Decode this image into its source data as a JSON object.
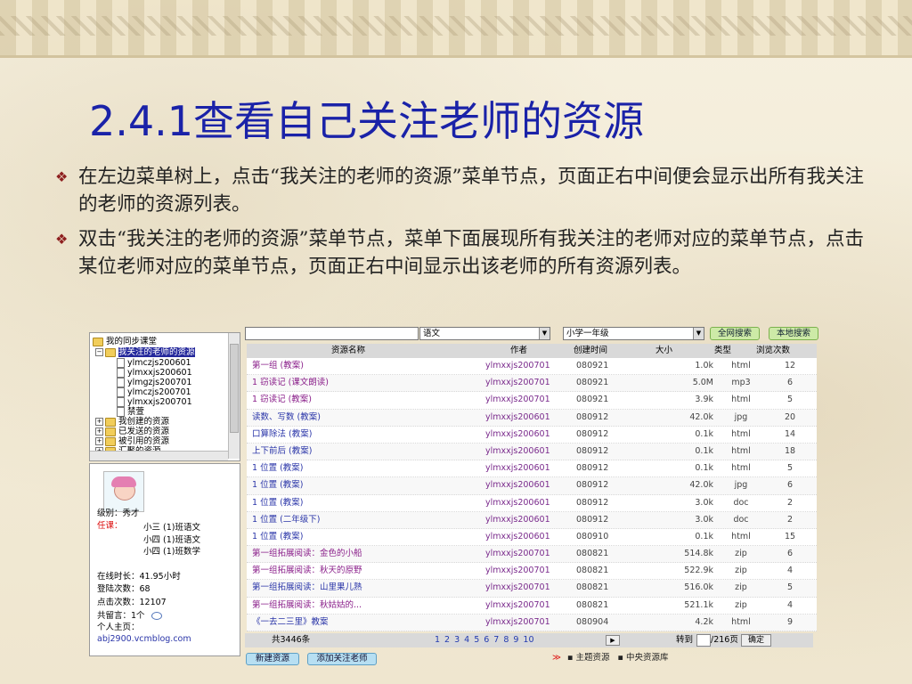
{
  "slide": {
    "title": "2.4.1查看自己关注老师的资源",
    "bullet_marker": "❖",
    "bullets": [
      "在左边菜单树上，点击“我关注的老师的资源”菜单节点，页面正右中间便会显示出所有我关注的老师的资源列表。",
      "双击“我关注的老师的资源”菜单节点，菜单下面展现所有我关注的老师对应的菜单节点，点击某位老师对应的菜单节点，页面正右中间显示出该老师的所有资源列表。"
    ]
  },
  "tree": {
    "root": "我的同步课堂",
    "selected": "我关注的老师的资源",
    "teachers": [
      "ylmczjs200601",
      "ylmxxjs200601",
      "ylmgzjs200701",
      "ylmczjs200701",
      "ylmxxjs200701"
    ],
    "extra_leaf": "禁萱",
    "groups": [
      "我创建的资源",
      "已发送的资源",
      "被引用的资源",
      "汇聚的资源"
    ]
  },
  "profile": {
    "level": "级别：秀才",
    "duty_label": "任课：",
    "duties": [
      "小三 (1)班语文",
      "小四 (1)班语文",
      "小四 (1)班数学"
    ],
    "online": "在线时长：41.95小时",
    "logins": "登陆次数：68",
    "clicks": "点击次数：12107",
    "messages": "共留言：1个",
    "homepage_label": "个人主页：",
    "homepage_url": "abj2900.vcmblog.com"
  },
  "search": {
    "keyword": "",
    "subject": "语文",
    "grade": "小学一年级",
    "btn_all": "全网搜索",
    "btn_local": "本地搜索"
  },
  "table": {
    "headers": [
      "资源名称",
      "作者",
      "创建时间",
      "大小",
      "类型",
      "浏览次数"
    ],
    "rows": [
      {
        "name": "第一组 (教案)",
        "author": "ylmxxjs200701",
        "date": "080921",
        "size": "1.0k",
        "type": "html",
        "views": "12",
        "pink": true
      },
      {
        "name": "1  窃读记 (课文朗读)",
        "author": "ylmxxjs200701",
        "date": "080921",
        "size": "5.0M",
        "type": "mp3",
        "views": "6",
        "pink": true
      },
      {
        "name": "1  窃读记 (教案)",
        "author": "ylmxxjs200701",
        "date": "080921",
        "size": "3.9k",
        "type": "html",
        "views": "5",
        "pink": true
      },
      {
        "name": "读数、写数 (教案)",
        "author": "ylmxxjs200601",
        "date": "080912",
        "size": "42.0k",
        "type": "jpg",
        "views": "20",
        "pink": false
      },
      {
        "name": "口算除法 (教案)",
        "author": "ylmxxjs200601",
        "date": "080912",
        "size": "0.1k",
        "type": "html",
        "views": "14",
        "pink": false
      },
      {
        "name": "上下前后 (教案)",
        "author": "ylmxxjs200601",
        "date": "080912",
        "size": "0.1k",
        "type": "html",
        "views": "18",
        "pink": false
      },
      {
        "name": "1 位置 (教案)",
        "author": "ylmxxjs200601",
        "date": "080912",
        "size": "0.1k",
        "type": "html",
        "views": "5",
        "pink": false
      },
      {
        "name": "1 位置 (教案)",
        "author": "ylmxxjs200601",
        "date": "080912",
        "size": "42.0k",
        "type": "jpg",
        "views": "6",
        "pink": false
      },
      {
        "name": "1 位置 (教案)",
        "author": "ylmxxjs200601",
        "date": "080912",
        "size": "3.0k",
        "type": "doc",
        "views": "2",
        "pink": false
      },
      {
        "name": "1 位置 (二年级下)",
        "author": "ylmxxjs200601",
        "date": "080912",
        "size": "3.0k",
        "type": "doc",
        "views": "2",
        "pink": false
      },
      {
        "name": "1 位置 (教案)",
        "author": "ylmxxjs200601",
        "date": "080910",
        "size": "0.1k",
        "type": "html",
        "views": "15",
        "pink": false
      },
      {
        "name": "第一组拓展阅读：金色的小船",
        "author": "ylmxxjs200701",
        "date": "080821",
        "size": "514.8k",
        "type": "zip",
        "views": "6",
        "pink": true
      },
      {
        "name": "第一组拓展阅读：秋天的原野",
        "author": "ylmxxjs200701",
        "date": "080821",
        "size": "522.9k",
        "type": "zip",
        "views": "4",
        "pink": true
      },
      {
        "name": "第一组拓展阅读：山里果儿熟",
        "author": "ylmxxjs200701",
        "date": "080821",
        "size": "516.0k",
        "type": "zip",
        "views": "5",
        "pink": false
      },
      {
        "name": "第一组拓展阅读：秋姑姑的...",
        "author": "ylmxxjs200701",
        "date": "080821",
        "size": "521.1k",
        "type": "zip",
        "views": "4",
        "pink": true
      },
      {
        "name": "《一去二三里》教案",
        "author": "ylmxxjs200701",
        "date": "080904",
        "size": "4.2k",
        "type": "html",
        "views": "9",
        "pink": false
      }
    ]
  },
  "pager": {
    "total": "共3446条",
    "pages": [
      "1",
      "2",
      "3",
      "4",
      "5",
      "6",
      "7",
      "8",
      "9",
      "10"
    ],
    "goto_label": "转到",
    "page_of": "/216页",
    "ok": "确定"
  },
  "bottom": {
    "new_resource": "新建资源",
    "add_teacher": "添加关注老师",
    "chev": "≫",
    "links": [
      "▪ 主题资源",
      "▪ 中央资源库"
    ]
  },
  "colors": {
    "title": "#1a22a8",
    "bullet_marker": "#8e1f1f",
    "selection": "#24289c",
    "link_blue": "#2a35a8",
    "link_purple": "#8a1f8a",
    "search_button": "#cdeaa7",
    "action_button": "#b7dff2"
  }
}
